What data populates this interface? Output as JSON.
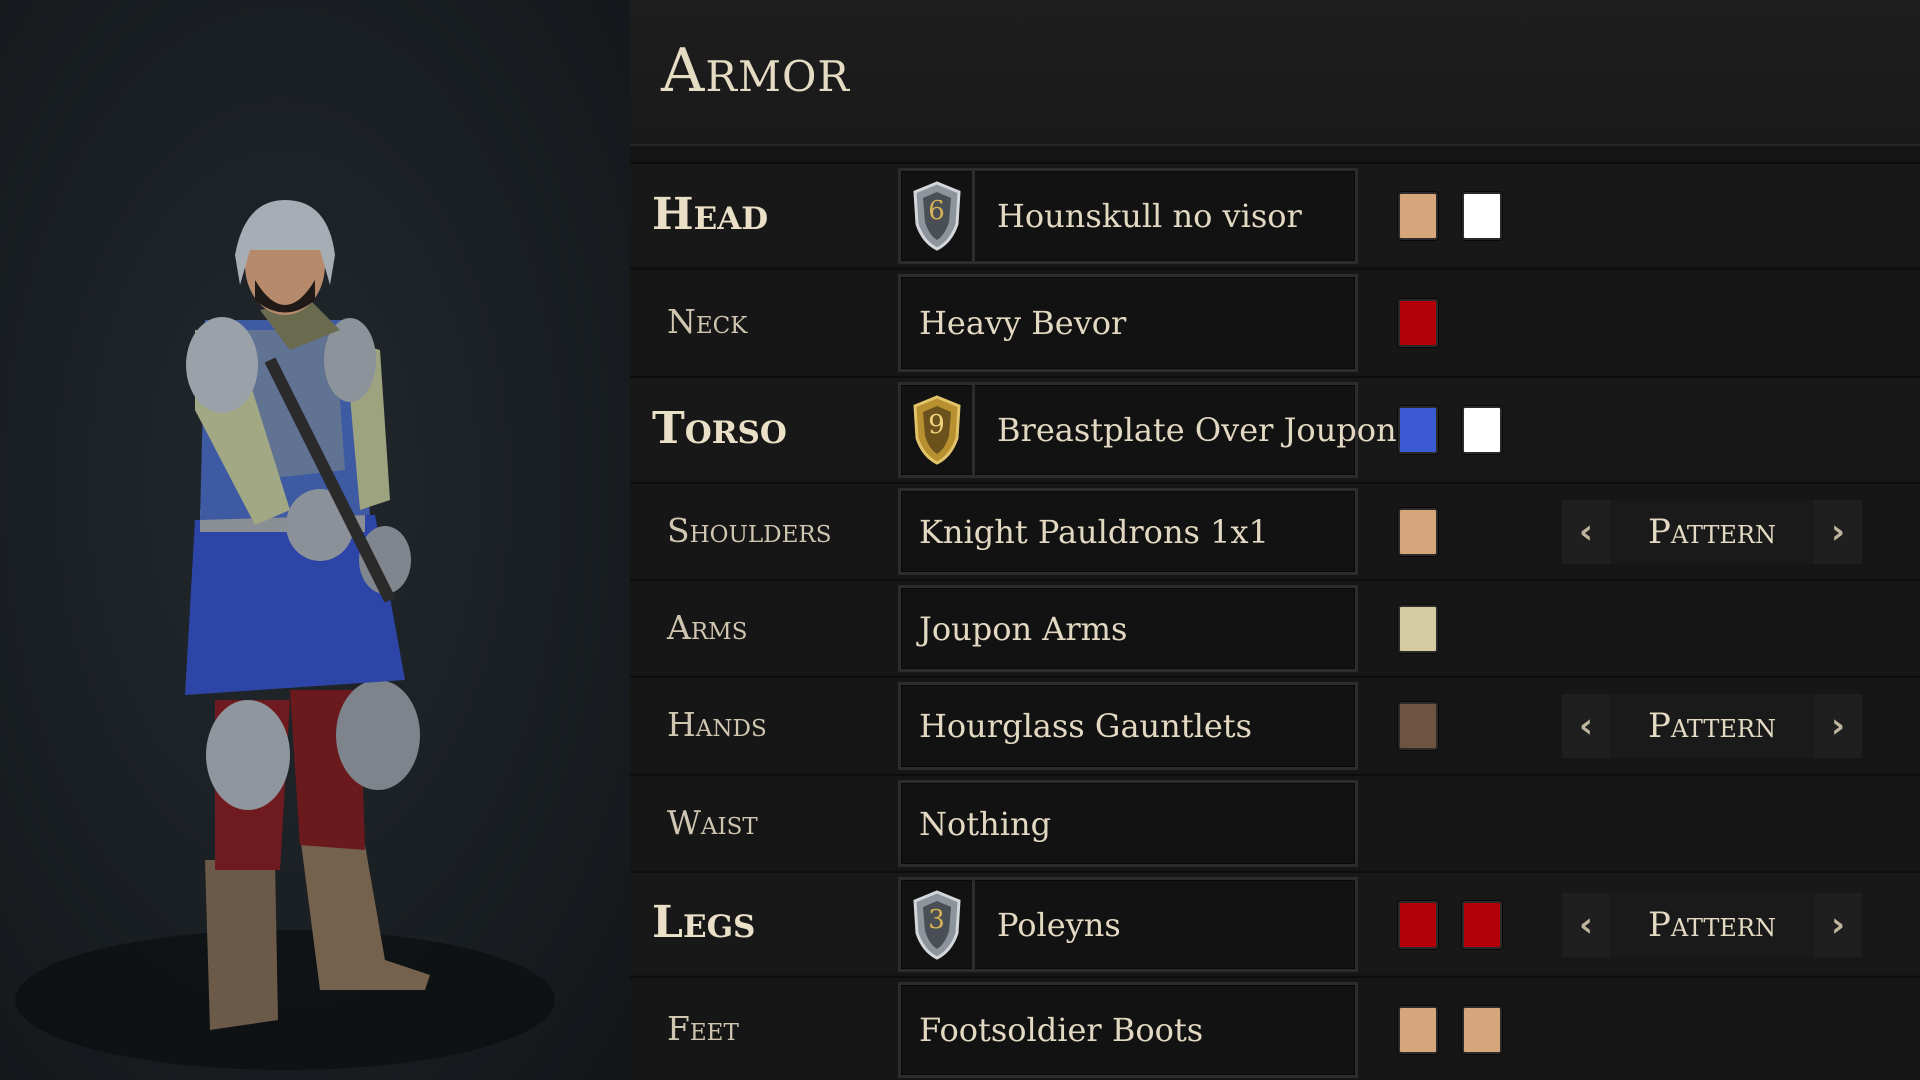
{
  "panel": {
    "title": "Armor"
  },
  "slots": [
    {
      "label": "Head",
      "item": "Hounskull no visor",
      "badge": "6",
      "badge_style": "silver",
      "colors": [
        "#d6a57c",
        "#ffffff"
      ],
      "pattern": null
    },
    {
      "label": "Neck",
      "item": "Heavy Bevor",
      "badge": null,
      "colors": [
        "#b40008"
      ],
      "pattern": null
    },
    {
      "label": "Torso",
      "item": "Breastplate Over Joupon",
      "badge": "9",
      "badge_style": "gold",
      "colors": [
        "#3c5ad2",
        "#ffffff"
      ],
      "pattern": null
    },
    {
      "label": "Shoulders",
      "item": "Knight Pauldrons 1x1",
      "badge": null,
      "colors": [
        "#d6a57c"
      ],
      "pattern": "Pattern"
    },
    {
      "label": "Arms",
      "item": "Joupon Arms",
      "badge": null,
      "colors": [
        "#d4cba0"
      ],
      "pattern": null
    },
    {
      "label": "Hands",
      "item": "Hourglass Gauntlets",
      "badge": null,
      "colors": [
        "#6e5440"
      ],
      "pattern": "Pattern"
    },
    {
      "label": "Waist",
      "item": "Nothing",
      "badge": null,
      "colors": [],
      "pattern": null
    },
    {
      "label": "Legs",
      "item": "Poleyns",
      "badge": "3",
      "badge_style": "silver",
      "colors": [
        "#b40008",
        "#b40008"
      ],
      "pattern": "Pattern"
    },
    {
      "label": "Feet",
      "item": "Footsoldier Boots",
      "badge": null,
      "colors": [
        "#d6a57c",
        "#d6a57c"
      ],
      "pattern": null
    }
  ],
  "icons": {
    "pattern_prev": "chevron-left-icon",
    "pattern_next": "chevron-right-icon",
    "badge": "shield-icon"
  },
  "theme": {
    "accent": "#e6dcc4",
    "gold": "#c9a44a",
    "silver": "#b8bcc2"
  }
}
